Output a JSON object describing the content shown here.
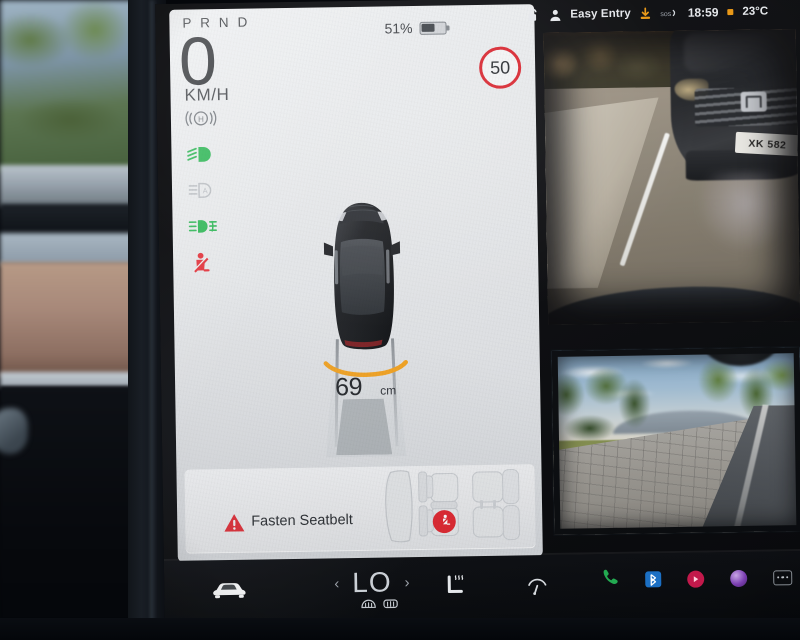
{
  "drive_panel": {
    "gear_indicator": "P R N D",
    "speed_value": "0",
    "speed_unit": "KM/H",
    "battery_percent_label": "51%",
    "battery_level": 51,
    "speed_limit": "50",
    "indicators": [
      {
        "name": "parking-brake",
        "label": "(H)",
        "color": "#6b7076",
        "state": "inactive"
      },
      {
        "name": "low-beam-headlight",
        "label": "low beam",
        "color": "#21b24b",
        "state": "active"
      },
      {
        "name": "auto-high-beam",
        "label": "auto high beam",
        "color": "#b6babf",
        "state": "inactive"
      },
      {
        "name": "front-fog-light",
        "label": "fog lights",
        "color": "#21b24b",
        "state": "active"
      },
      {
        "name": "seatbelt-warning",
        "label": "seatbelt",
        "color": "#e0262f",
        "state": "alert"
      }
    ],
    "parking_distance": "69",
    "parking_distance_unit": "cm",
    "warning": {
      "message": "Fasten Seatbelt",
      "icon": "warning-triangle-icon",
      "accent_color": "#e0262f"
    }
  },
  "status_bar": {
    "lock_icon": "unlocked-padlock-icon",
    "profile_icon": "person-icon",
    "profile_name": "Easy Entry",
    "download_icon": "download-icon",
    "signal_icon": "signal-icon",
    "time": "18:59",
    "temperature": "23°C"
  },
  "cameras": {
    "top": {
      "name": "front-camera",
      "scene": "fisheye front view of paved driveway with dark Honda sedan parked ahead at sunset",
      "plate_text": "XK 582"
    },
    "bottom": {
      "name": "side-repeater-camera",
      "scene": "brick paved path with grass, trees and evening sky"
    }
  },
  "bottom_bar": {
    "car_icon": "car-front-icon",
    "decrease_icon": "chevron-left-icon",
    "temperature": "LO",
    "increase_icon": "chevron-right-icon",
    "defrost_front_icon": "front-defrost-icon",
    "defrost_rear_icon": "rear-defrost-icon",
    "seat_heater_icon": "heated-seat-icon",
    "wiper_icon": "wiper-icon",
    "apps": [
      {
        "name": "phone-app",
        "icon": "phone-icon",
        "color": "#21a950"
      },
      {
        "name": "bluetooth-app",
        "icon": "bluetooth-icon",
        "color": "#1a6fc4"
      },
      {
        "name": "media-app",
        "icon": "media-play-icon",
        "color": "#c2184a"
      },
      {
        "name": "assistant-app",
        "icon": "assistant-orb-icon",
        "color": "#7d3fb5"
      },
      {
        "name": "more-apps",
        "icon": "more-dots-icon",
        "color": "#8d939a"
      }
    ]
  }
}
